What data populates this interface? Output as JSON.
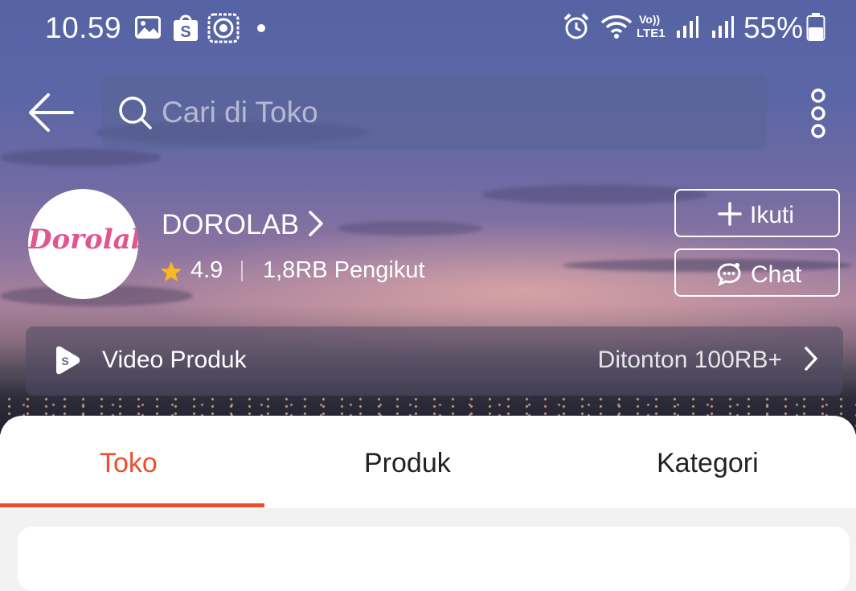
{
  "status_bar": {
    "time": "10.59",
    "battery": "55%",
    "icons": [
      "gallery-icon",
      "shopee-bag-icon",
      "quran-app-icon",
      "dot-icon",
      "alarm-icon",
      "wifi-icon",
      "volte-lte1-icon",
      "signal-1-icon",
      "signal-2-icon",
      "battery-icon"
    ],
    "volte_label": "Vo))",
    "lte_label": "LTE1"
  },
  "header": {
    "search_placeholder": "Cari di Toko"
  },
  "shop": {
    "logo_text": "Dorolab",
    "name": "DOROLAB",
    "rating": "4.9",
    "followers": "1,8RB Pengikut",
    "follow_label": "Ikuti",
    "chat_label": "Chat"
  },
  "video": {
    "label": "Video Produk",
    "views": "Ditonton 100RB+"
  },
  "tabs": [
    {
      "label": "Toko",
      "active": true
    },
    {
      "label": "Produk",
      "active": false
    },
    {
      "label": "Kategori",
      "active": false
    }
  ],
  "colors": {
    "accent": "#ee4d2d",
    "logo_pink": "#e0568f",
    "star": "#f6b91e"
  }
}
